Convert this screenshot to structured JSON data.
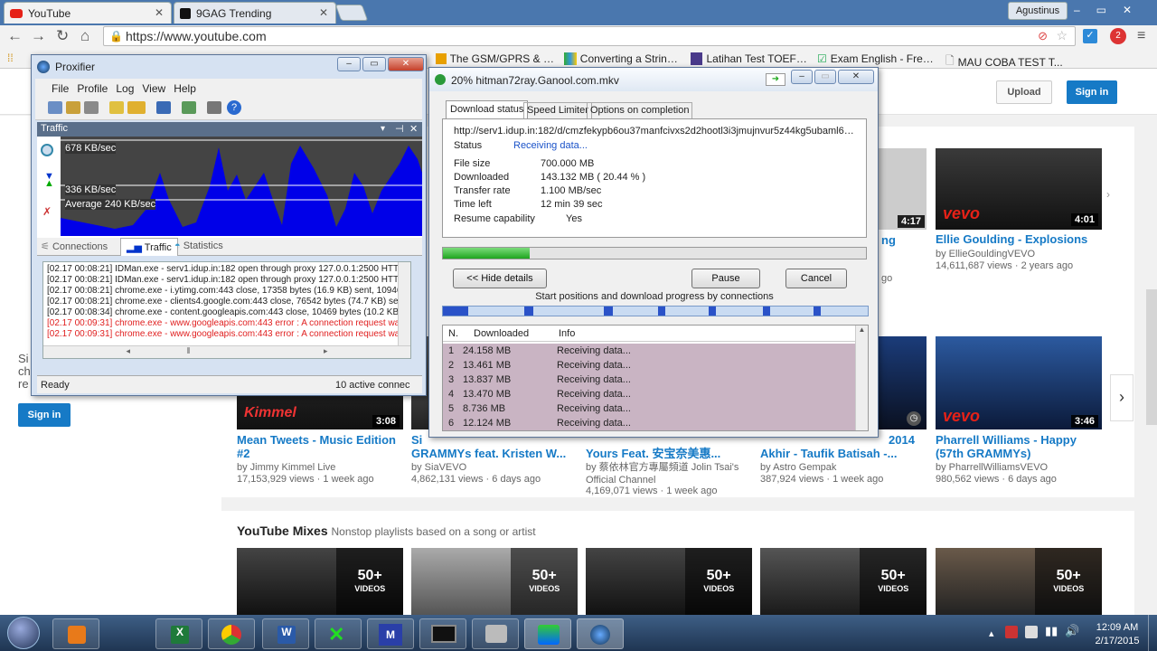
{
  "browser": {
    "tabs": [
      {
        "label": "YouTube",
        "icon": "youtube-favicon-icon"
      },
      {
        "label": "9GAG Trending",
        "icon": "9gag-favicon-icon"
      }
    ],
    "user": "Agustinus",
    "url": "https://www.youtube.com",
    "bookmarks": [
      "The GSM/GPRS & G...",
      "Converting a String ...",
      "Latihan Test TOEFL ...",
      "Exam English - Free ...",
      "MAU COBA TEST T..."
    ]
  },
  "youtube": {
    "upload_label": "Upload",
    "signin_label": "Sign in",
    "sidebar_signin_label": "Sign in",
    "sidebar_text": [
      "Si",
      "ch",
      "re"
    ],
    "row1": [
      {
        "title": "Ellie Goulding - Explosions",
        "channel": "by EllieGouldingVEVO",
        "stats": "14,611,687 views · 2 years ago",
        "duration": "4:01",
        "badge": "vevo"
      },
      {
        "duration": "4:17"
      }
    ],
    "partial_row1": [
      "ng",
      "go"
    ],
    "row2": [
      {
        "title": "Mean Tweets - Music Edition #2",
        "channel": "by Jimmy Kimmel Live",
        "stats": "17,153,929 views · 1 week ago",
        "duration": "3:08"
      },
      {
        "title": "GRAMMYs feat. Kristen W...",
        "channel": "by SiaVEVO",
        "stats": "4,862,131 views · 6 days ago",
        "prefix": "Si"
      },
      {
        "title": "Yours Feat. 安宝奈美惠...",
        "channel": "by 蔡依林官方專屬頻道 Jolin Tsai's Official Channel",
        "stats": "4,169,071 views · 1 week ago"
      },
      {
        "title": "Akhir - Taufik Batisah -...",
        "title_top": "2014",
        "channel": "by Astro Gempak",
        "stats": "387,924 views · 1 week ago"
      },
      {
        "title": "Pharrell Williams - Happy (57th GRAMMYs)",
        "channel": "by PharrellWilliamsVEVO",
        "stats": "980,562 views · 6 days ago",
        "duration": "3:46",
        "badge": "vevo"
      }
    ],
    "mixes_title": "YouTube Mixes",
    "mixes_subtitle": "Nonstop playlists based on a song or artist",
    "mix_count": "50+",
    "mix_label": "VIDEOS"
  },
  "proxifier": {
    "title": "Proxifier",
    "menu": [
      "File",
      "Profile",
      "Log",
      "View",
      "Help"
    ],
    "traffic_header": "Traffic",
    "rate_top": "678 KB/sec",
    "rate_mid": "336 KB/sec",
    "rate_avg": "Average 240 KB/sec",
    "tabs": [
      "Connections",
      "Traffic",
      "Statistics"
    ],
    "log": [
      {
        "text": "[02.17 00:08:21] IDMan.exe - serv1.idup.in:182 open through proxy 127.0.0.1:2500 HTTP",
        "err": false
      },
      {
        "text": "[02.17 00:08:21] IDMan.exe - serv1.idup.in:182 open through proxy 127.0.0.1:2500 HTTP",
        "err": false
      },
      {
        "text": "[02.17 00:08:21] chrome.exe - i.ytimg.com:443 close, 17358 bytes (16.9 KB) sent, 1094612",
        "err": false
      },
      {
        "text": "[02.17 00:08:21] chrome.exe - clients4.google.com:443 close, 76542 bytes (74.7 KB) sent,",
        "err": false
      },
      {
        "text": "[02.17 00:08:34] chrome.exe - content.googleapis.com:443 close, 10469 bytes (10.2 KB) s",
        "err": false
      },
      {
        "text": "[02.17 00:09:31] chrome.exe - www.googleapis.com:443 error : A connection request was",
        "err": true
      },
      {
        "text": "[02.17 00:09:31] chrome.exe - www.googleapis.com:443 error : A connection request was",
        "err": true
      }
    ],
    "status_left": "Ready",
    "status_right": "10 active connec"
  },
  "idm": {
    "title": "20% hitman72ray.Ganool.com.mkv",
    "tabs": [
      "Download status",
      "Speed Limiter",
      "Options on completion"
    ],
    "url": "http://serv1.idup.in:182/d/cmzfekypb6ou37manfcivxs2d2hootl3i3jmujnvur5z44kg5ubaml6z/hitman7",
    "status_label": "Status",
    "status_value": "Receiving data...",
    "fields": [
      {
        "label": "File size",
        "value": "700.000  MB"
      },
      {
        "label": "Downloaded",
        "value": "143.132  MB  ( 20.44 % )"
      },
      {
        "label": "Transfer rate",
        "value": "1.100  MB/sec"
      },
      {
        "label": "Time left",
        "value": "12 min 39 sec"
      },
      {
        "label": "Resume capability",
        "value": "Yes"
      }
    ],
    "progress": 0.2044,
    "hide_details_label": "<< Hide details",
    "pause_label": "Pause",
    "cancel_label": "Cancel",
    "connections_caption": "Start positions and download progress by connections",
    "table_headers": [
      "N.",
      "Downloaded",
      "Info"
    ],
    "rows": [
      {
        "n": "1",
        "dl": "24.158  MB",
        "info": "Receiving data..."
      },
      {
        "n": "2",
        "dl": "13.461  MB",
        "info": "Receiving data..."
      },
      {
        "n": "3",
        "dl": "13.837  MB",
        "info": "Receiving data..."
      },
      {
        "n": "4",
        "dl": "13.470  MB",
        "info": "Receiving data..."
      },
      {
        "n": "5",
        "dl": "8.736  MB",
        "info": "Receiving data..."
      },
      {
        "n": "6",
        "dl": "12.124  MB",
        "info": "Receiving data..."
      }
    ]
  },
  "taskbar": {
    "time": "12:09 AM",
    "date": "2/17/2015",
    "apps": [
      "windows-media-player-icon",
      "excel-icon",
      "chrome-icon",
      "word-icon",
      "xmedia-icon",
      "m-app-icon",
      "screen-app-icon",
      "network-tool-icon",
      "idm-icon",
      "proxifier-icon"
    ]
  }
}
